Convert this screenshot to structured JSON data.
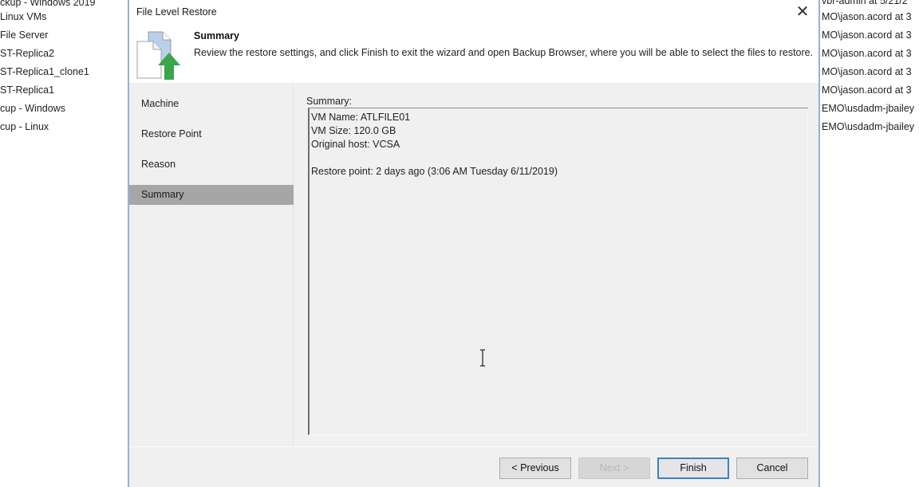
{
  "background_left_list": [
    "ckup - Windows 2019",
    "Linux VMs",
    "File Server",
    "ST-Replica2",
    "ST-Replica1_clone1",
    "ST-Replica1",
    "cup - Windows",
    "cup - Linux"
  ],
  "background_right_list": [
    "vbr-admin at 5/21/2",
    "MO\\jason.acord at 3",
    "MO\\jason.acord at 3",
    "MO\\jason.acord at 3",
    "MO\\jason.acord at 3",
    "MO\\jason.acord at 3",
    "EMO\\usdadm-jbailey",
    "EMO\\usdadm-jbailey"
  ],
  "dialog": {
    "title": "File Level Restore",
    "close_icon": "close-icon",
    "header": {
      "icon": "file-restore-icon",
      "title": "Summary",
      "description": "Review the restore settings, and click Finish to exit the wizard and open Backup Browser, where you will be able to select the files to restore."
    },
    "nav": {
      "items": [
        {
          "label": "Machine",
          "active": false
        },
        {
          "label": "Restore Point",
          "active": false
        },
        {
          "label": "Reason",
          "active": false
        },
        {
          "label": "Summary",
          "active": true
        }
      ]
    },
    "content": {
      "summary_label": "Summary:",
      "summary_lines": [
        "VM Name: ATLFILE01",
        "VM Size: 120.0 GB",
        "Original host: VCSA",
        "",
        "Restore point: 2 days ago (3:06 AM Tuesday 6/11/2019)"
      ]
    },
    "buttons": {
      "previous": "< Previous",
      "next": "Next >",
      "finish": "Finish",
      "cancel": "Cancel"
    }
  },
  "colors": {
    "active_nav": "#a6a6a6",
    "dialog_border": "#8fb4d8",
    "default_button_border": "#3b82c4",
    "icon_arrow_green": "#3aa54a",
    "icon_page_blue": "#b9d0ea"
  }
}
